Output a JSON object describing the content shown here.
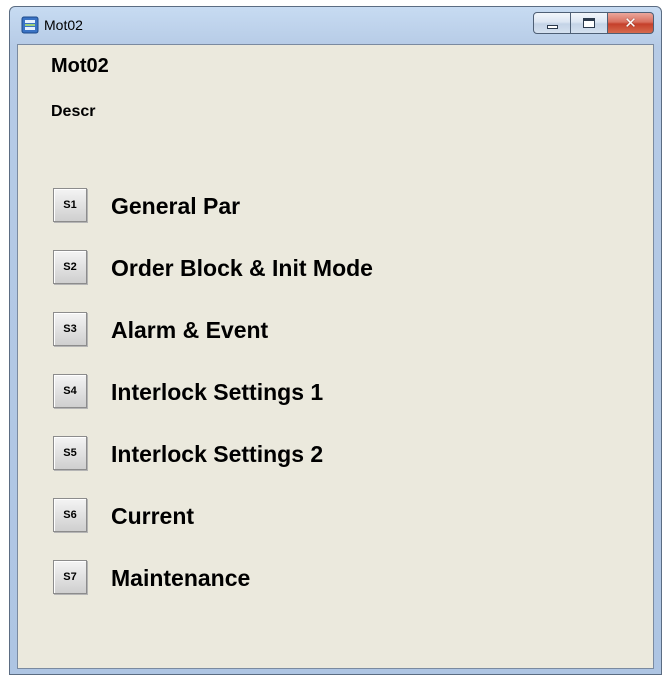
{
  "window": {
    "title": "Mot02",
    "app_icon": "faceplate-icon",
    "controls": {
      "minimize_icon": "minimize-icon",
      "maximize_icon": "maximize-icon",
      "close_icon": "close-icon",
      "close_glyph": "✕"
    }
  },
  "content": {
    "heading": "Mot02",
    "description": "Descr"
  },
  "menu": {
    "items": [
      {
        "button": "S1",
        "label": "General Par"
      },
      {
        "button": "S2",
        "label": "Order Block & Init Mode"
      },
      {
        "button": "S3",
        "label": "Alarm & Event"
      },
      {
        "button": "S4",
        "label": "Interlock Settings 1"
      },
      {
        "button": "S5",
        "label": "Interlock Settings 2"
      },
      {
        "button": "S6",
        "label": "Current"
      },
      {
        "button": "S7",
        "label": "Maintenance"
      }
    ]
  },
  "colors": {
    "frame": "#b6cbe6",
    "client_background": "#ebe9dd",
    "close_button": "#c5402b"
  }
}
